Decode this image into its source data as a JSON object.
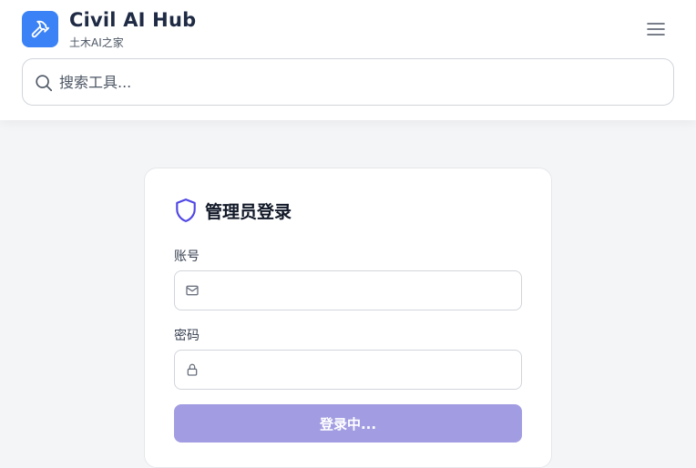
{
  "header": {
    "title": "Civil AI Hub",
    "subtitle": "土木AI之家",
    "logo_icon": "hammer-icon",
    "menu_icon": "hamburger-menu-icon"
  },
  "search": {
    "placeholder": "搜索工具...",
    "value": "",
    "icon": "search-icon"
  },
  "login": {
    "title": "管理员登录",
    "title_icon": "shield-icon",
    "account_label": "账号",
    "account_value": "",
    "account_icon": "mail-icon",
    "password_label": "密码",
    "password_value": "",
    "password_icon": "lock-icon",
    "submit_label": "登录中...",
    "submit_state": "loading"
  },
  "colors": {
    "brand_blue": "#3b82f6",
    "shield_purple": "#4f46e5",
    "button_bg": "#a29de2",
    "page_bg": "#f4f5f7"
  }
}
